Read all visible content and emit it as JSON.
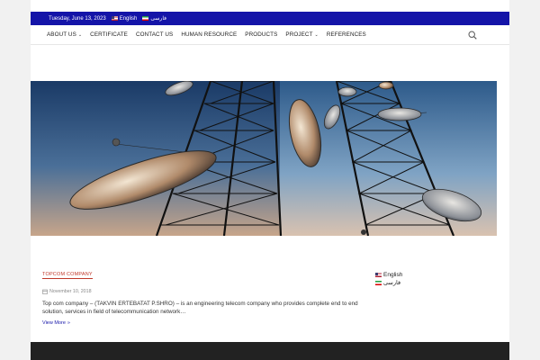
{
  "topbar": {
    "date": "Tuesday, June 13, 2023",
    "languages": [
      {
        "label": "English",
        "flag": "us-flag-icon"
      },
      {
        "label": "فارسی",
        "flag": "iran-flag-icon"
      }
    ],
    "bg_color": "#1414a8"
  },
  "nav": {
    "items": [
      {
        "label": "ABOUT US",
        "has_dropdown": true
      },
      {
        "label": "CERTIFICATE",
        "has_dropdown": false
      },
      {
        "label": "CONTACT US",
        "has_dropdown": false
      },
      {
        "label": "HUMAN RESOURCE",
        "has_dropdown": false
      },
      {
        "label": "PRODUCTS",
        "has_dropdown": false
      },
      {
        "label": "PROJECT",
        "has_dropdown": true
      },
      {
        "label": "REFERENCES",
        "has_dropdown": false
      }
    ],
    "search_icon": "search-icon"
  },
  "post": {
    "category": "TOPCOM COMPANY",
    "date": "November 10, 2018",
    "excerpt": "Top com company – (TAKVIN ERTEBATAT P.SHRO) – is an engineering telecom company who provides complete end to end solution, services in field of telecommunication network…",
    "read_more": "View More"
  },
  "sidebar": {
    "languages": [
      {
        "label": "English"
      },
      {
        "label": "فارسی"
      }
    ]
  },
  "colors": {
    "accent": "#1414a8",
    "category": "#c0392b",
    "footer": "#222222"
  }
}
